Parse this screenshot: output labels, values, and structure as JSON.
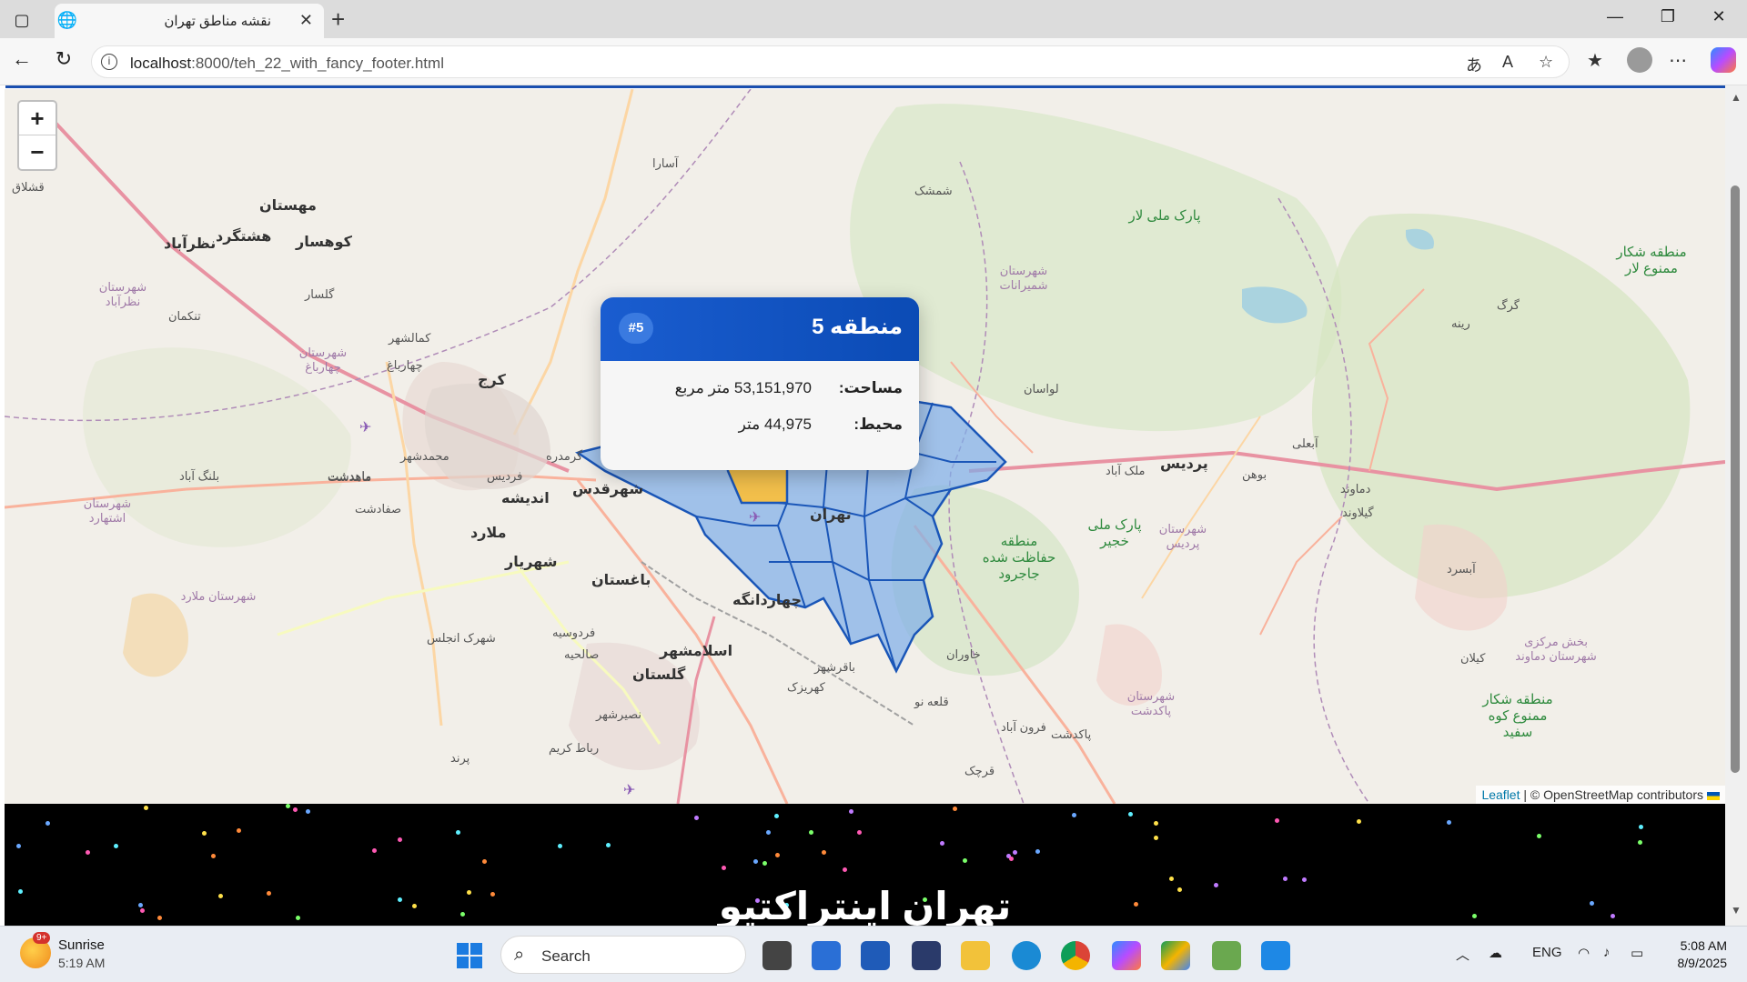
{
  "browser": {
    "tab_title": "نقشه مناطق تهران",
    "url_host": "localhost",
    "url_rest": ":8000/teh_22_with_fancy_footer.html"
  },
  "map": {
    "zoom_in": "+",
    "zoom_out": "−",
    "attribution_link": "Leaflet",
    "attribution_rest": " | © OpenStreetMap contributors",
    "labels": [
      {
        "text": "مهستان",
        "cls": "big"
      },
      {
        "text": "هشتگرد",
        "cls": "big"
      },
      {
        "text": "کوهسار",
        "cls": "big"
      },
      {
        "text": "نظرآباد",
        "cls": "big"
      },
      {
        "text": "کرج",
        "cls": "big"
      },
      {
        "text": "اندیشه",
        "cls": "big"
      },
      {
        "text": "شهرقدس",
        "cls": "big"
      },
      {
        "text": "ملارد",
        "cls": "big"
      },
      {
        "text": "شهریار",
        "cls": "big"
      },
      {
        "text": "باغستان",
        "cls": "big"
      },
      {
        "text": "چهاردانگه",
        "cls": "big"
      },
      {
        "text": "اسلامشهر",
        "cls": "big"
      },
      {
        "text": "گلستان",
        "cls": "big"
      },
      {
        "text": "تهران",
        "cls": "big"
      },
      {
        "text": "پردیس",
        "cls": "big"
      },
      {
        "text": "لواسان",
        "cls": ""
      },
      {
        "text": "شمشک",
        "cls": ""
      },
      {
        "text": "آسارا",
        "cls": ""
      },
      {
        "text": "گرمدره",
        "cls": ""
      },
      {
        "text": "ماهدشت",
        "cls": ""
      },
      {
        "text": "صفادشت",
        "cls": ""
      },
      {
        "text": "بوهن",
        "cls": ""
      },
      {
        "text": "آبعلی",
        "cls": ""
      },
      {
        "text": "دماوند",
        "cls": ""
      },
      {
        "text": "گیلاوند",
        "cls": ""
      },
      {
        "text": "آبسرد",
        "cls": ""
      },
      {
        "text": "کیلان",
        "cls": ""
      },
      {
        "text": "پاکدشت",
        "cls": ""
      },
      {
        "text": "قرچک",
        "cls": ""
      },
      {
        "text": "قلعه نو",
        "cls": ""
      },
      {
        "text": "خاوران",
        "cls": ""
      },
      {
        "text": "فرون آباد",
        "cls": ""
      },
      {
        "text": "کهریزک",
        "cls": ""
      },
      {
        "text": "باقرشهر",
        "cls": ""
      },
      {
        "text": "نصیرشهر",
        "cls": ""
      },
      {
        "text": "رباط کریم",
        "cls": ""
      },
      {
        "text": "پرند",
        "cls": ""
      },
      {
        "text": "شهرک انجلس",
        "cls": ""
      },
      {
        "text": "فردوسیه",
        "cls": ""
      },
      {
        "text": "صالحیه",
        "cls": ""
      },
      {
        "text": "بلنگ آباد",
        "cls": ""
      },
      {
        "text": "ملک آباد",
        "cls": ""
      },
      {
        "text": "گلسار",
        "cls": ""
      },
      {
        "text": "تنکمان",
        "cls": ""
      },
      {
        "text": "چهارباغ",
        "cls": ""
      },
      {
        "text": "کمالشهر",
        "cls": ""
      },
      {
        "text": "محمدشهر",
        "cls": ""
      },
      {
        "text": "ماهدشت",
        "cls": ""
      },
      {
        "text": "فردیس",
        "cls": ""
      },
      {
        "text": "قشلاق",
        "cls": ""
      },
      {
        "text": "گرگ",
        "cls": ""
      },
      {
        "text": "رینه",
        "cls": ""
      },
      {
        "text": "پارک ملی لار",
        "cls": "green"
      },
      {
        "text": "منطقه شکار ممنوع لار",
        "cls": "green"
      },
      {
        "text": "منطقه حفاظت شده جاجرود",
        "cls": "green"
      },
      {
        "text": "منطقه شکار ممنوع کوه سفید",
        "cls": "green"
      },
      {
        "text": "پارک ملی خجیر",
        "cls": "green"
      },
      {
        "text": "شهرستان نظرآباد",
        "cls": "purple"
      },
      {
        "text": "شهرستان اشتهارد",
        "cls": "purple"
      },
      {
        "text": "شهرستان ملارد",
        "cls": "purple"
      },
      {
        "text": "شهرستان چهارباغ",
        "cls": "purple"
      },
      {
        "text": "شهرستان شمیرانات",
        "cls": "purple"
      },
      {
        "text": "شهرستان پردیس",
        "cls": "purple"
      },
      {
        "text": "شهرستان پاکدشت",
        "cls": "purple"
      },
      {
        "text": "بخش مرکزی شهرستان دماوند",
        "cls": "purple"
      }
    ]
  },
  "popup": {
    "title": "منطقه 5",
    "badge": "#5",
    "area_label": "مساحت:",
    "area_value": "53,151,970 متر مربع",
    "perimeter_label": "محیط:",
    "perimeter_value": "44,975 متر"
  },
  "footer": {
    "title": "تهران اینتراکتیو"
  },
  "taskbar": {
    "weather_label": "Sunrise",
    "weather_time": "5:19 AM",
    "weather_badge": "9+",
    "search_placeholder": "Search",
    "lang": "ENG",
    "clock_time": "5:08 AM",
    "clock_date": "8/9/2025"
  }
}
